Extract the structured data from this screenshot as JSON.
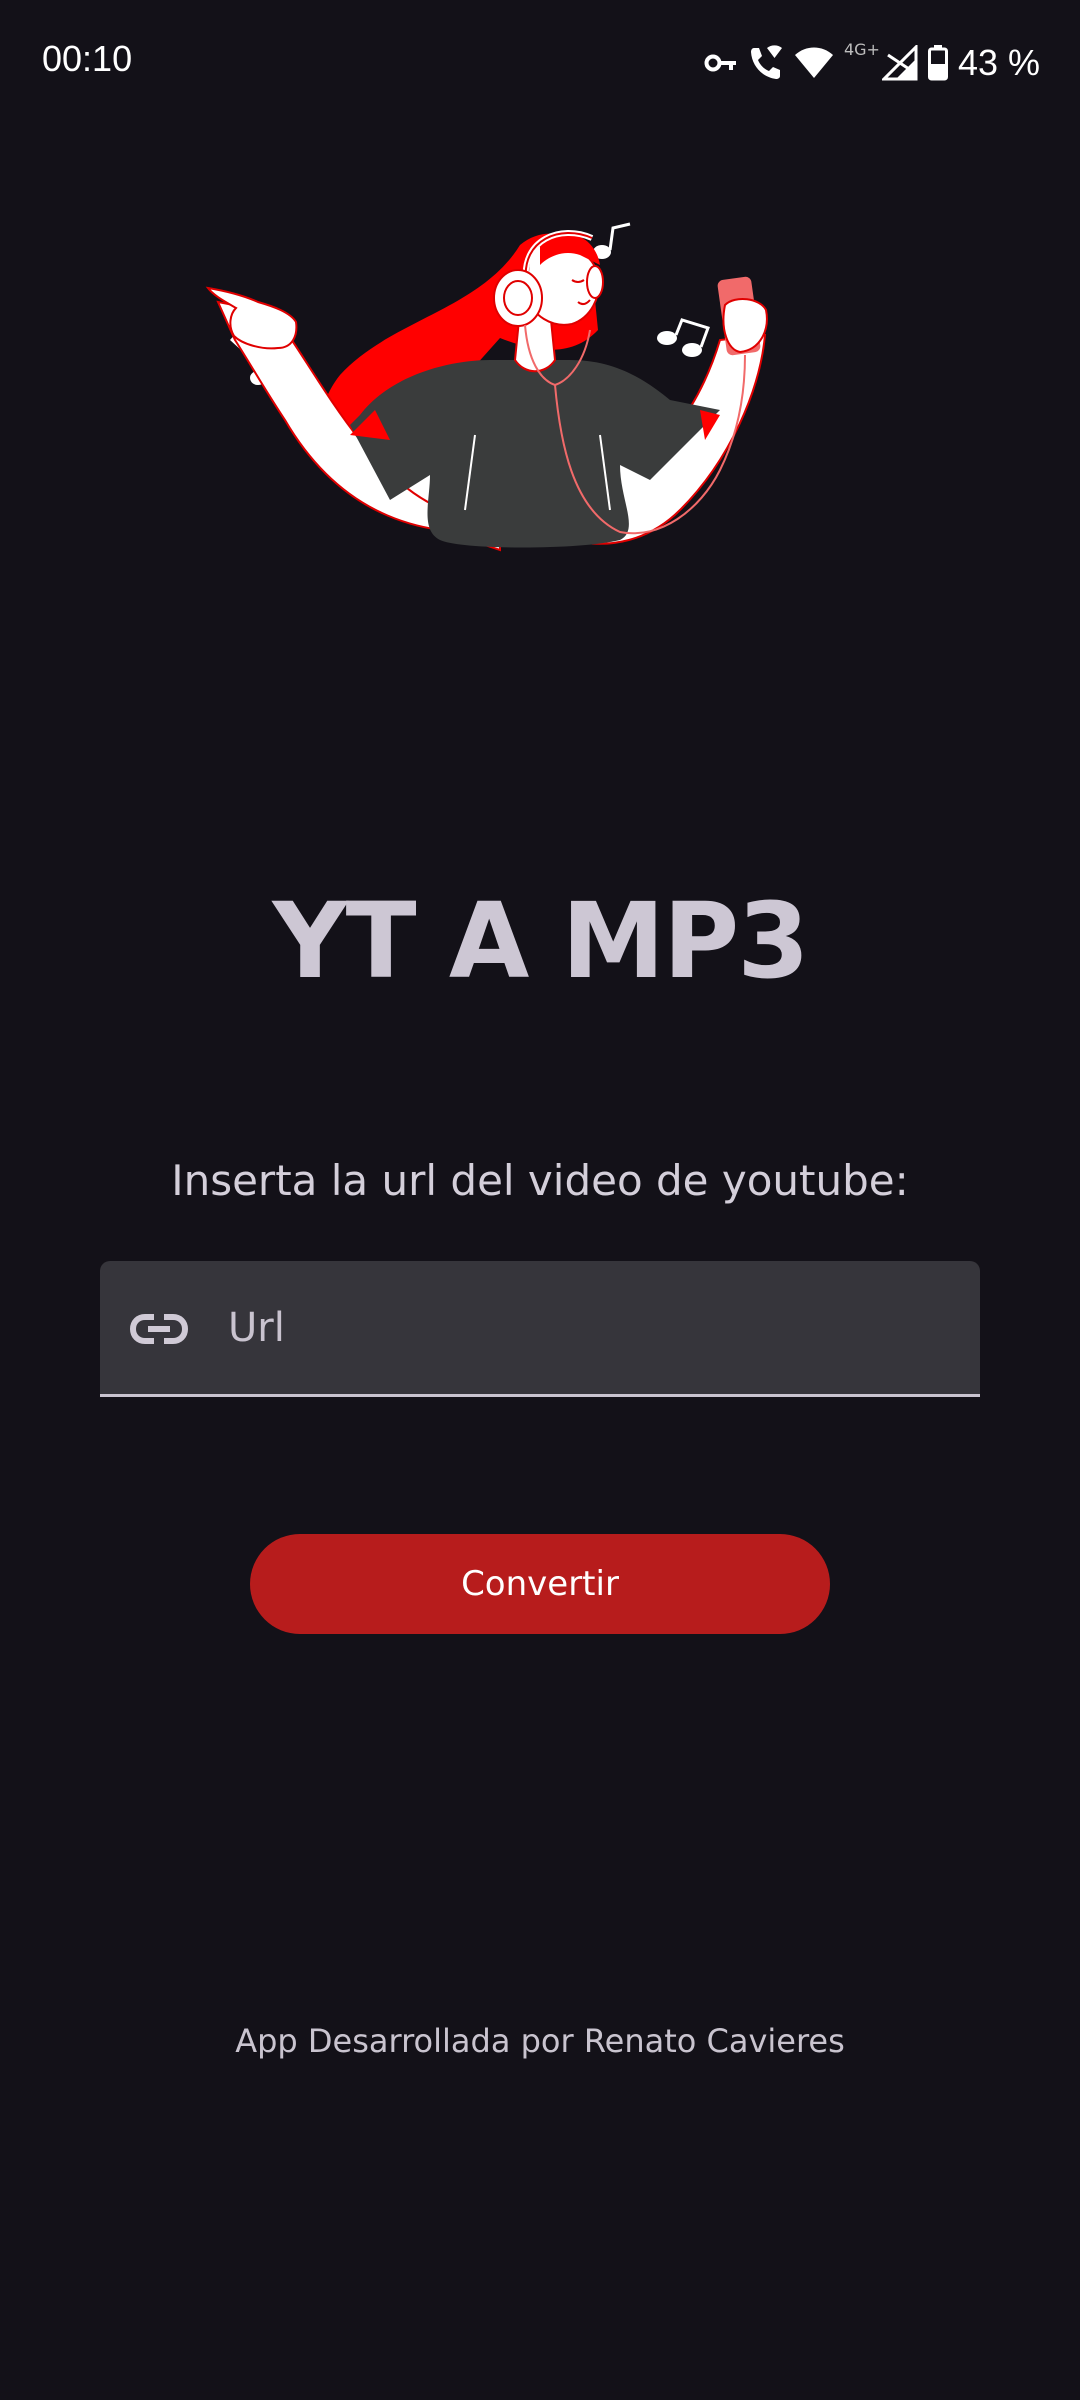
{
  "status_bar": {
    "time": "00:10",
    "network_label": "4G+",
    "battery_percent": "43 %",
    "icons": [
      "vpn-key-icon",
      "wifi-calling-icon",
      "wifi-icon",
      "signal-icon",
      "battery-icon"
    ]
  },
  "illustration": {
    "description_icon": "girl-listening-music-illustration",
    "colors": {
      "hair": "#ff0000",
      "skin": "#ffffff",
      "shirt": "#3a3c3c",
      "phone": "#f16a6a",
      "outline": "#e00000"
    }
  },
  "app": {
    "title": "YT A MP3"
  },
  "form": {
    "instruction": "Inserta la url del video de youtube:",
    "url_placeholder": "Url",
    "url_value": "",
    "url_icon": "link-icon",
    "convert_label": "Convertir"
  },
  "footer": {
    "credits": "App Desarrollada por Renato Cavieres"
  },
  "theme": {
    "background": "#131118",
    "accent": "#b71c1c",
    "title_color": "#cdc7d4",
    "field_background": "#36353b"
  }
}
